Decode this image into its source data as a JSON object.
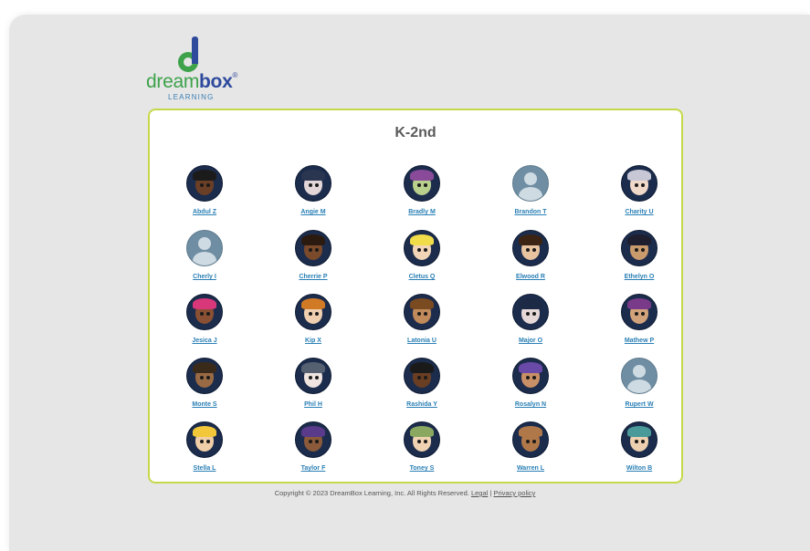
{
  "brand": {
    "word_dream": "dream",
    "word_box": "box",
    "tm": "®",
    "subtitle": "LEARNING",
    "colors": {
      "green": "#3da24a",
      "blue": "#2e4a9c",
      "teal": "#3a7fb8"
    }
  },
  "panel": {
    "title": "K-2nd",
    "border_color": "#c6d84a"
  },
  "students": [
    {
      "name": "Abdul Z",
      "avatar": "skin-dark-curly"
    },
    {
      "name": "Angie M",
      "avatar": "skin-pale-dark-hair"
    },
    {
      "name": "Bradly M",
      "avatar": "skin-green-cap"
    },
    {
      "name": "Brandon T",
      "avatar": "placeholder"
    },
    {
      "name": "Charity U",
      "avatar": "skin-light-silver-hair"
    },
    {
      "name": "Cherly I",
      "avatar": "placeholder"
    },
    {
      "name": "Cherrie P",
      "avatar": "skin-dark-afro"
    },
    {
      "name": "Cletus Q",
      "avatar": "skin-light-blonde"
    },
    {
      "name": "Elwood R",
      "avatar": "skin-light-brown-hair"
    },
    {
      "name": "Ethelyn O",
      "avatar": "skin-tan-spiky"
    },
    {
      "name": "Jesica J",
      "avatar": "skin-dark-pink-hair"
    },
    {
      "name": "Kip X",
      "avatar": "skin-light-orange-hair"
    },
    {
      "name": "Latonia U",
      "avatar": "skin-tan-braids"
    },
    {
      "name": "Major O",
      "avatar": "skin-pale-navy-hair"
    },
    {
      "name": "Mathew P",
      "avatar": "skin-tan-purple-hair"
    },
    {
      "name": "Monte S",
      "avatar": "skin-brown-short"
    },
    {
      "name": "Phil H",
      "avatar": "skin-pale-spiky-gray"
    },
    {
      "name": "Rashida Y",
      "avatar": "skin-dark-glasses"
    },
    {
      "name": "Rosalyn N",
      "avatar": "skin-tan-purple-bob"
    },
    {
      "name": "Rupert W",
      "avatar": "placeholder"
    },
    {
      "name": "Stella L",
      "avatar": "skin-light-blonde-pigtails"
    },
    {
      "name": "Taylor F",
      "avatar": "skin-brown-purple-hair"
    },
    {
      "name": "Toney S",
      "avatar": "skin-light-green-cap"
    },
    {
      "name": "Warren L",
      "avatar": "skin-brown-bald"
    },
    {
      "name": "Wilton B",
      "avatar": "skin-light-teal-cap"
    }
  ],
  "avatar_styles": {
    "skin-dark-curly": {
      "skin": "#6b3f26",
      "hair": "#1b1b1b"
    },
    "skin-pale-dark-hair": {
      "skin": "#e2d6d8",
      "hair": "#2a3550"
    },
    "skin-green-cap": {
      "skin": "#b9cf8c",
      "hair": "#8a4a9a"
    },
    "skin-light-silver-hair": {
      "skin": "#f1d9c9",
      "hair": "#c7c7d6"
    },
    "skin-dark-afro": {
      "skin": "#7a4a2b",
      "hair": "#2b1a10"
    },
    "skin-light-blonde": {
      "skin": "#f2d4b6",
      "hair": "#f1dd4a"
    },
    "skin-light-brown-hair": {
      "skin": "#e8c3a0",
      "hair": "#3b2414"
    },
    "skin-tan-spiky": {
      "skin": "#c99a6c",
      "hair": "#1e1e2e"
    },
    "skin-dark-pink-hair": {
      "skin": "#8a5034",
      "hair": "#d8377a"
    },
    "skin-light-orange-hair": {
      "skin": "#efcfb0",
      "hair": "#d07a26"
    },
    "skin-tan-braids": {
      "skin": "#c08a5a",
      "hair": "#7a4a20"
    },
    "skin-pale-navy-hair": {
      "skin": "#e6d8d6",
      "hair": "#1d2a46"
    },
    "skin-tan-purple-hair": {
      "skin": "#d2a27a",
      "hair": "#7a3a8a"
    },
    "skin-brown-short": {
      "skin": "#9a6a44",
      "hair": "#3a2a1a"
    },
    "skin-pale-spiky-gray": {
      "skin": "#efe4df",
      "hair": "#556070"
    },
    "skin-dark-glasses": {
      "skin": "#6a3e22",
      "hair": "#1a1a1a"
    },
    "skin-tan-purple-bob": {
      "skin": "#c98f66",
      "hair": "#6a4aa8"
    },
    "skin-light-blonde-pigtails": {
      "skin": "#f0cfa8",
      "hair": "#f2c83a"
    },
    "skin-brown-purple-hair": {
      "skin": "#8a5a3a",
      "hair": "#5a3a8a"
    },
    "skin-light-green-cap": {
      "skin": "#efd2b2",
      "hair": "#8aa860"
    },
    "skin-brown-bald": {
      "skin": "#b07848",
      "hair": "#b07848"
    },
    "skin-light-teal-cap": {
      "skin": "#ecd0b0",
      "hair": "#4a9a9a"
    }
  },
  "footer": {
    "copyright": "Copyright © 2023 DreamBox Learning, Inc. All Rights Reserved.",
    "legal": "Legal",
    "separator": "|",
    "privacy": "Privacy policy"
  }
}
